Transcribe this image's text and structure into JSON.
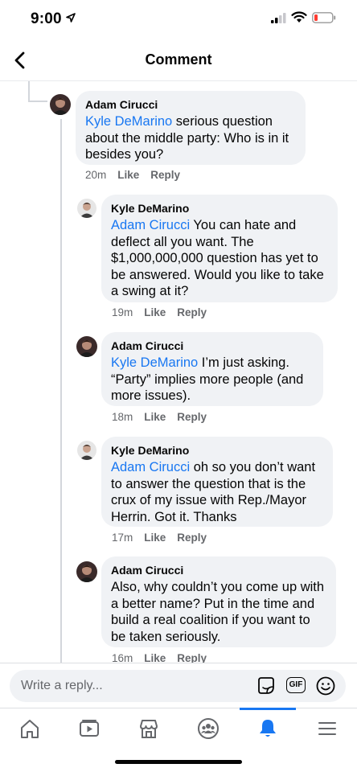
{
  "status_bar": {
    "time": "9:00"
  },
  "header": {
    "title": "Comment"
  },
  "comments": [
    {
      "author": "Adam Cirucci",
      "mention": "Kyle DeMarino",
      "text": " serious question about the middle party: Who is in it besides you?",
      "time": "20m",
      "like": "Like",
      "reply": "Reply"
    },
    {
      "author": "Kyle DeMarino",
      "mention": "Adam Cirucci",
      "text": " You can hate and deflect all you want. The $1,000,000,000 question has yet to be answered. Would you like to take a swing at it?",
      "time": "19m",
      "like": "Like",
      "reply": "Reply"
    },
    {
      "author": "Adam Cirucci",
      "mention": "Kyle DeMarino",
      "text": " I’m just asking. “Party” implies more people (and more issues).",
      "time": "18m",
      "like": "Like",
      "reply": "Reply"
    },
    {
      "author": "Kyle DeMarino",
      "mention": "Adam Cirucci",
      "text": " oh so you don’t want to answer the question that is the crux of my issue with Rep./Mayor Herrin. Got it. Thanks",
      "time": "17m",
      "like": "Like",
      "reply": "Reply"
    },
    {
      "author": "Adam Cirucci",
      "mention": "",
      "text": "Also, why couldn’t you come up with a better name? Put in the time and build a real coalition if you want to be taken seriously.",
      "time": "16m",
      "like": "Like",
      "reply": "Reply"
    }
  ],
  "reply_box": {
    "placeholder": "Write a reply...",
    "gif_label": "GIF"
  },
  "nav": {
    "tabs": [
      "home-icon",
      "watch-icon",
      "marketplace-icon",
      "groups-icon",
      "notifications-icon",
      "menu-icon"
    ],
    "active": "notifications-icon"
  },
  "colors": {
    "accent": "#1877f2",
    "bubble": "#f0f2f5",
    "meta": "#65676b"
  }
}
